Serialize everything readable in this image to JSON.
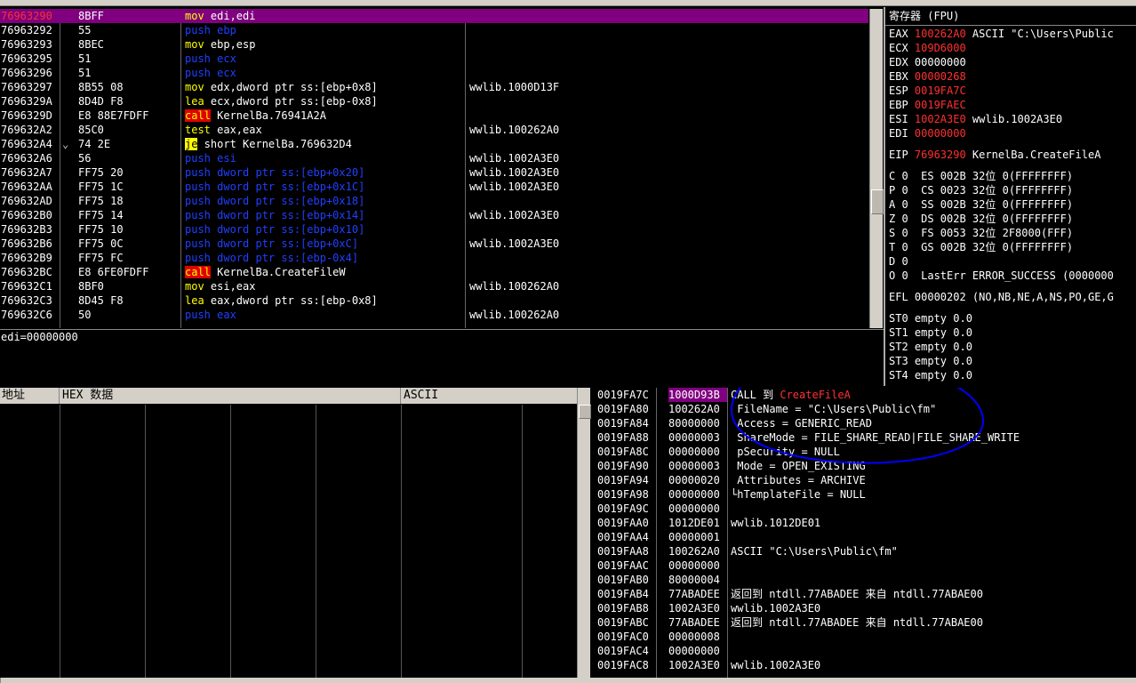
{
  "disasm": [
    {
      "addr": "76963290",
      "addr_red": true,
      "selected": true,
      "mark": "",
      "hex": "8BFF",
      "mn": "mov",
      "mn_class": "mov",
      "ops": "edi,edi",
      "ops_green": false,
      "cmt": ""
    },
    {
      "addr": "76963292",
      "mark": "",
      "hex": "55",
      "mn": "push",
      "mn_class": "push",
      "ops": "ebp",
      "cmt": ""
    },
    {
      "addr": "76963293",
      "mark": "",
      "hex": "8BEC",
      "mn": "mov",
      "mn_class": "mov",
      "ops": "ebp,esp",
      "cmt": ""
    },
    {
      "addr": "76963295",
      "mark": "",
      "hex": "51",
      "mn": "push",
      "mn_class": "push",
      "ops": "ecx",
      "cmt": ""
    },
    {
      "addr": "76963296",
      "mark": "",
      "hex": "51",
      "mn": "push",
      "mn_class": "push",
      "ops": "ecx",
      "cmt": ""
    },
    {
      "addr": "76963297",
      "mark": "",
      "hex": "8B55 08",
      "mn": "mov",
      "mn_class": "mov",
      "ops": "edx,dword ptr ss:[ebp+0x8]",
      "cmt": "wwlib.1000D13F"
    },
    {
      "addr": "7696329A",
      "mark": "",
      "hex": "8D4D F8",
      "mn": "lea",
      "mn_class": "mov",
      "ops": "ecx,dword ptr ss:[ebp-0x8]",
      "cmt": ""
    },
    {
      "addr": "7696329D",
      "mark": "",
      "hex": "E8 88E7FDFF",
      "mn": "call",
      "mn_class": "call",
      "ops": "KernelBa.76941A2A",
      "cmt": ""
    },
    {
      "addr": "769632A2",
      "mark": "",
      "hex": "85C0",
      "mn": "test",
      "mn_class": "mov",
      "ops": "eax,eax",
      "cmt": "wwlib.100262A0"
    },
    {
      "addr": "769632A4",
      "mark": "⌄",
      "hex": "74 2E",
      "mn": "je",
      "mn_class": "je",
      "ops": "short KernelBa.769632D4",
      "cmt": ""
    },
    {
      "addr": "769632A6",
      "mark": "",
      "hex": "56",
      "mn": "push",
      "mn_class": "push",
      "ops": "esi",
      "cmt": "wwlib.1002A3E0"
    },
    {
      "addr": "769632A7",
      "mark": "",
      "hex": "FF75 20",
      "mn": "push",
      "mn_class": "push",
      "ops": "dword ptr ss:[ebp+0x20]",
      "cmt": "wwlib.1002A3E0"
    },
    {
      "addr": "769632AA",
      "mark": "",
      "hex": "FF75 1C",
      "mn": "push",
      "mn_class": "push",
      "ops": "dword ptr ss:[ebp+0x1C]",
      "cmt": "wwlib.1002A3E0"
    },
    {
      "addr": "769632AD",
      "mark": "",
      "hex": "FF75 18",
      "mn": "push",
      "mn_class": "push",
      "ops": "dword ptr ss:[ebp+0x18]",
      "cmt": ""
    },
    {
      "addr": "769632B0",
      "mark": "",
      "hex": "FF75 14",
      "mn": "push",
      "mn_class": "push",
      "ops": "dword ptr ss:[ebp+0x14]",
      "cmt": "wwlib.1002A3E0"
    },
    {
      "addr": "769632B3",
      "mark": "",
      "hex": "FF75 10",
      "mn": "push",
      "mn_class": "push",
      "ops": "dword ptr ss:[ebp+0x10]",
      "cmt": ""
    },
    {
      "addr": "769632B6",
      "mark": "",
      "hex": "FF75 0C",
      "mn": "push",
      "mn_class": "push",
      "ops": "dword ptr ss:[ebp+0xC]",
      "cmt": "wwlib.1002A3E0"
    },
    {
      "addr": "769632B9",
      "mark": "",
      "hex": "FF75 FC",
      "mn": "push",
      "mn_class": "push",
      "ops": "dword ptr ss:[ebp-0x4]",
      "cmt": ""
    },
    {
      "addr": "769632BC",
      "mark": "",
      "hex": "E8 6FE0FDFF",
      "mn": "call",
      "mn_class": "call",
      "ops": "KernelBa.CreateFileW",
      "cmt": ""
    },
    {
      "addr": "769632C1",
      "mark": "",
      "hex": "8BF0",
      "mn": "mov",
      "mn_class": "mov",
      "ops": "esi,eax",
      "cmt": "wwlib.100262A0"
    },
    {
      "addr": "769632C3",
      "mark": "",
      "hex": "8D45 F8",
      "mn": "lea",
      "mn_class": "mov",
      "ops": "eax,dword ptr ss:[ebp-0x8]",
      "cmt": ""
    },
    {
      "addr": "769632C6",
      "mark": "",
      "hex": "50",
      "mn": "push",
      "mn_class": "push",
      "ops": "eax",
      "cmt": "wwlib.100262A0"
    }
  ],
  "info_text": "edi=00000000",
  "registers": {
    "title": "寄存器 (FPU)",
    "lines": [
      {
        "name": "EAX",
        "val": "100262A0",
        "val_red": true,
        "rest": " ASCII \"C:\\Users\\Public"
      },
      {
        "name": "ECX",
        "val": "109D6000",
        "val_red": true,
        "rest": ""
      },
      {
        "name": "EDX",
        "val": "00000000",
        "val_red": false,
        "rest": ""
      },
      {
        "name": "EBX",
        "val": "00000268",
        "val_red": true,
        "rest": ""
      },
      {
        "name": "ESP",
        "val": "0019FA7C",
        "val_red": true,
        "rest": ""
      },
      {
        "name": "EBP",
        "val": "0019FAEC",
        "val_red": true,
        "rest": ""
      },
      {
        "name": "ESI",
        "val": "1002A3E0",
        "val_red": true,
        "rest": " wwlib.1002A3E0"
      },
      {
        "name": "EDI",
        "val": "00000000",
        "val_red": true,
        "rest": ""
      }
    ],
    "eip": {
      "name": "EIP",
      "val": "76963290",
      "rest": " KernelBa.CreateFileA"
    },
    "flags": [
      "C 0  ES 002B 32位 0(FFFFFFFF)",
      "P 0  CS 0023 32位 0(FFFFFFFF)",
      "A 0  SS 002B 32位 0(FFFFFFFF)",
      "Z 0  DS 002B 32位 0(FFFFFFFF)",
      "S 0  FS 0053 32位 2F8000(FFF)",
      "T 0  GS 002B 32位 0(FFFFFFFF)",
      "D 0",
      "O 0  LastErr ERROR_SUCCESS (0000000"
    ],
    "efl": "EFL 00000202 (NO,NB,NE,A,NS,PO,GE,G",
    "st": [
      "ST0 empty 0.0",
      "ST1 empty 0.0",
      "ST2 empty 0.0",
      "ST3 empty 0.0",
      "ST4 empty 0.0"
    ]
  },
  "dump": {
    "headers": {
      "addr": "地址",
      "hex": "HEX 数据",
      "ascii": "ASCII"
    }
  },
  "stack": [
    {
      "addr": "0019FA7C",
      "val": "1000D93B",
      "cmt": "CALL 到 CreateFileA",
      "selected": true,
      "cmt_pre": "CALL 到 ",
      "cmt_red": "CreateFileA"
    },
    {
      "addr": "0019FA80",
      "val": "100262A0",
      "cmt": " FileName = \"C:\\Users\\Public\\fm\""
    },
    {
      "addr": "0019FA84",
      "val": "80000000",
      "cmt": " Access = GENERIC_READ"
    },
    {
      "addr": "0019FA88",
      "val": "00000003",
      "cmt": " ShareMode = FILE_SHARE_READ|FILE_SHARE_WRITE"
    },
    {
      "addr": "0019FA8C",
      "val": "00000000",
      "cmt": " pSecurity = NULL"
    },
    {
      "addr": "0019FA90",
      "val": "00000003",
      "cmt": " Mode = OPEN_EXISTING"
    },
    {
      "addr": "0019FA94",
      "val": "00000020",
      "cmt": " Attributes = ARCHIVE"
    },
    {
      "addr": "0019FA98",
      "val": "00000000",
      "cmt": "└hTemplateFile = NULL"
    },
    {
      "addr": "0019FA9C",
      "val": "00000000",
      "cmt": ""
    },
    {
      "addr": "0019FAA0",
      "val": "1012DE01",
      "cmt": "wwlib.1012DE01"
    },
    {
      "addr": "0019FAA4",
      "val": "00000001",
      "cmt": ""
    },
    {
      "addr": "0019FAA8",
      "val": "100262A0",
      "cmt": "ASCII \"C:\\Users\\Public\\fm\""
    },
    {
      "addr": "0019FAAC",
      "val": "00000000",
      "cmt": ""
    },
    {
      "addr": "0019FAB0",
      "val": "80000004",
      "cmt": ""
    },
    {
      "addr": "0019FAB4",
      "val": "77ABADEE",
      "cmt": "返回到 ntdll.77ABADEE 来自 ntdll.77ABAE00"
    },
    {
      "addr": "0019FAB8",
      "val": "1002A3E0",
      "cmt": "wwlib.1002A3E0"
    },
    {
      "addr": "0019FABC",
      "val": "77ABADEE",
      "cmt": "返回到 ntdll.77ABADEE 来自 ntdll.77ABAE00"
    },
    {
      "addr": "0019FAC0",
      "val": "00000008",
      "cmt": ""
    },
    {
      "addr": "0019FAC4",
      "val": "00000000",
      "cmt": ""
    },
    {
      "addr": "0019FAC8",
      "val": "1002A3E0",
      "cmt": "wwlib.1002A3E0"
    }
  ],
  "colors": {
    "selection": "#800080",
    "push": "#2040ff",
    "mnemonic": "#ffff00",
    "call_bg": "#e00000",
    "annotation": "#0000ff"
  }
}
